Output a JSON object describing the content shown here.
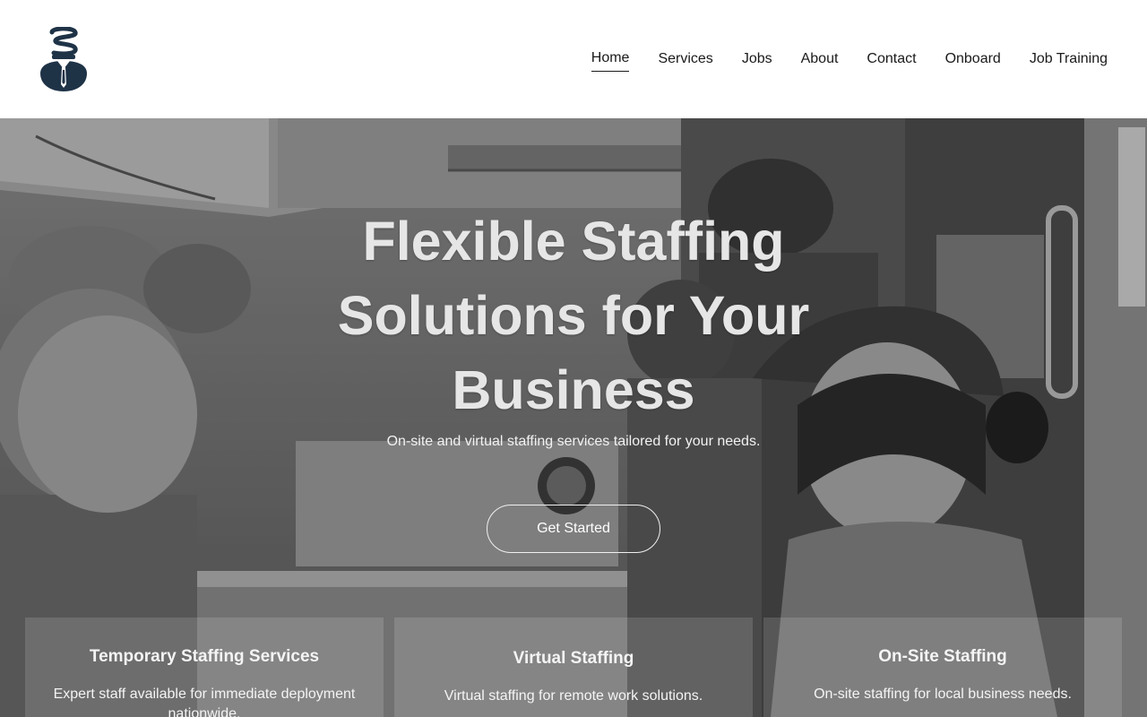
{
  "brand": {
    "logo_icon": "staffing-agent-logo-icon",
    "primary_color": "#1f3347"
  },
  "nav": {
    "items": [
      {
        "label": "Home",
        "active": true
      },
      {
        "label": "Services"
      },
      {
        "label": "Jobs"
      },
      {
        "label": "About"
      },
      {
        "label": "Contact"
      },
      {
        "label": "Onboard"
      },
      {
        "label": "Job Training"
      }
    ]
  },
  "hero": {
    "title": "Flexible Staffing Solutions for Your Business",
    "subtitle": "On-site and virtual staffing services tailored for your needs.",
    "cta_label": "Get Started",
    "background": "grayscale photo of workers at a food stand"
  },
  "cards": [
    {
      "title": "Temporary Staffing Services",
      "text": "Expert staff available for immediate deployment nationwide."
    },
    {
      "title": "Virtual Staffing",
      "text": "Virtual staffing for remote work solutions."
    },
    {
      "title": "On-Site Staffing",
      "text": "On-site staffing for local business needs."
    }
  ]
}
